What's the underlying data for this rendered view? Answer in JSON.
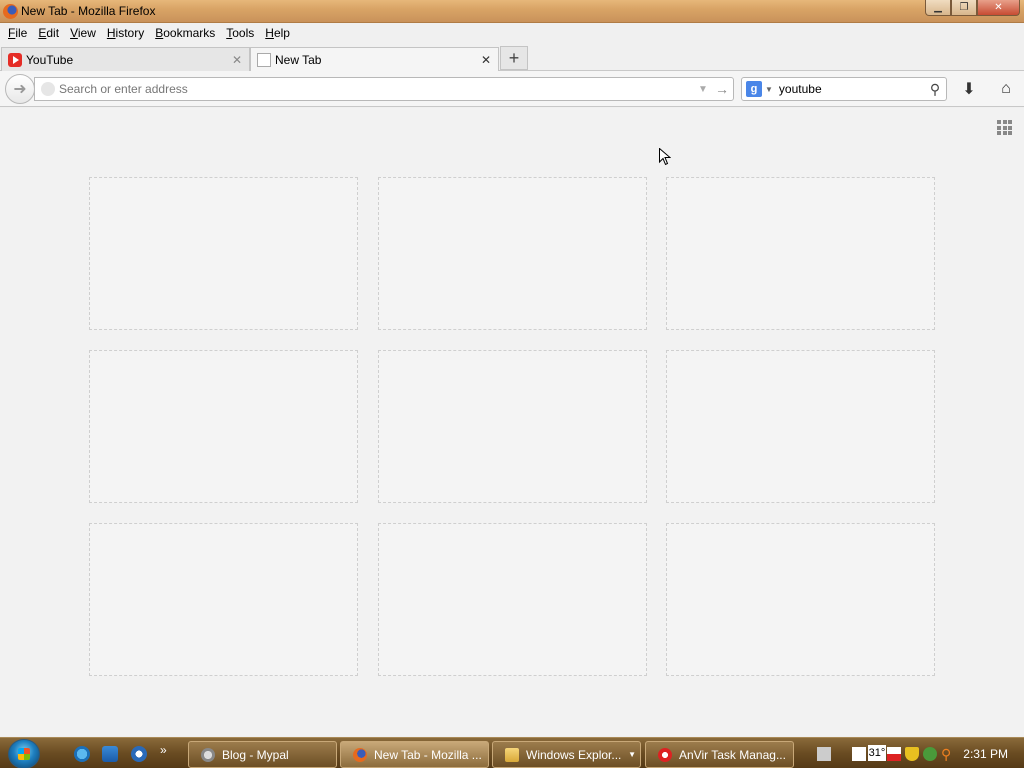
{
  "window": {
    "title": "New Tab - Mozilla Firefox"
  },
  "menubar": {
    "items": [
      "File",
      "Edit",
      "View",
      "History",
      "Bookmarks",
      "Tools",
      "Help"
    ],
    "mnemonics": [
      "F",
      "E",
      "V",
      "H",
      "B",
      "T",
      "H"
    ]
  },
  "tabs": [
    {
      "label": "YouTube",
      "icon": "youtube-icon",
      "active": false
    },
    {
      "label": "New Tab",
      "icon": "blank-page-icon",
      "active": true
    }
  ],
  "navbar": {
    "url_placeholder": "Search or enter address",
    "url_value": "",
    "search_engine": "google-icon",
    "search_value": "youtube"
  },
  "newtab": {
    "tile_count": 9
  },
  "taskbar": {
    "tasks": [
      {
        "label": "Blog - Mypal",
        "icon": "blog-icon"
      },
      {
        "label": "New Tab - Mozilla ...",
        "icon": "firefox-icon"
      },
      {
        "label": "Windows Explor...",
        "icon": "folder-icon"
      },
      {
        "label": "AnVir Task Manag...",
        "icon": "anvir-icon"
      }
    ],
    "temperature": "31°",
    "clock": "2:31 PM"
  },
  "colors": {
    "titlebar": "#d9a466",
    "taskbar": "#6a4c22",
    "content_bg": "#f2f2f2"
  }
}
